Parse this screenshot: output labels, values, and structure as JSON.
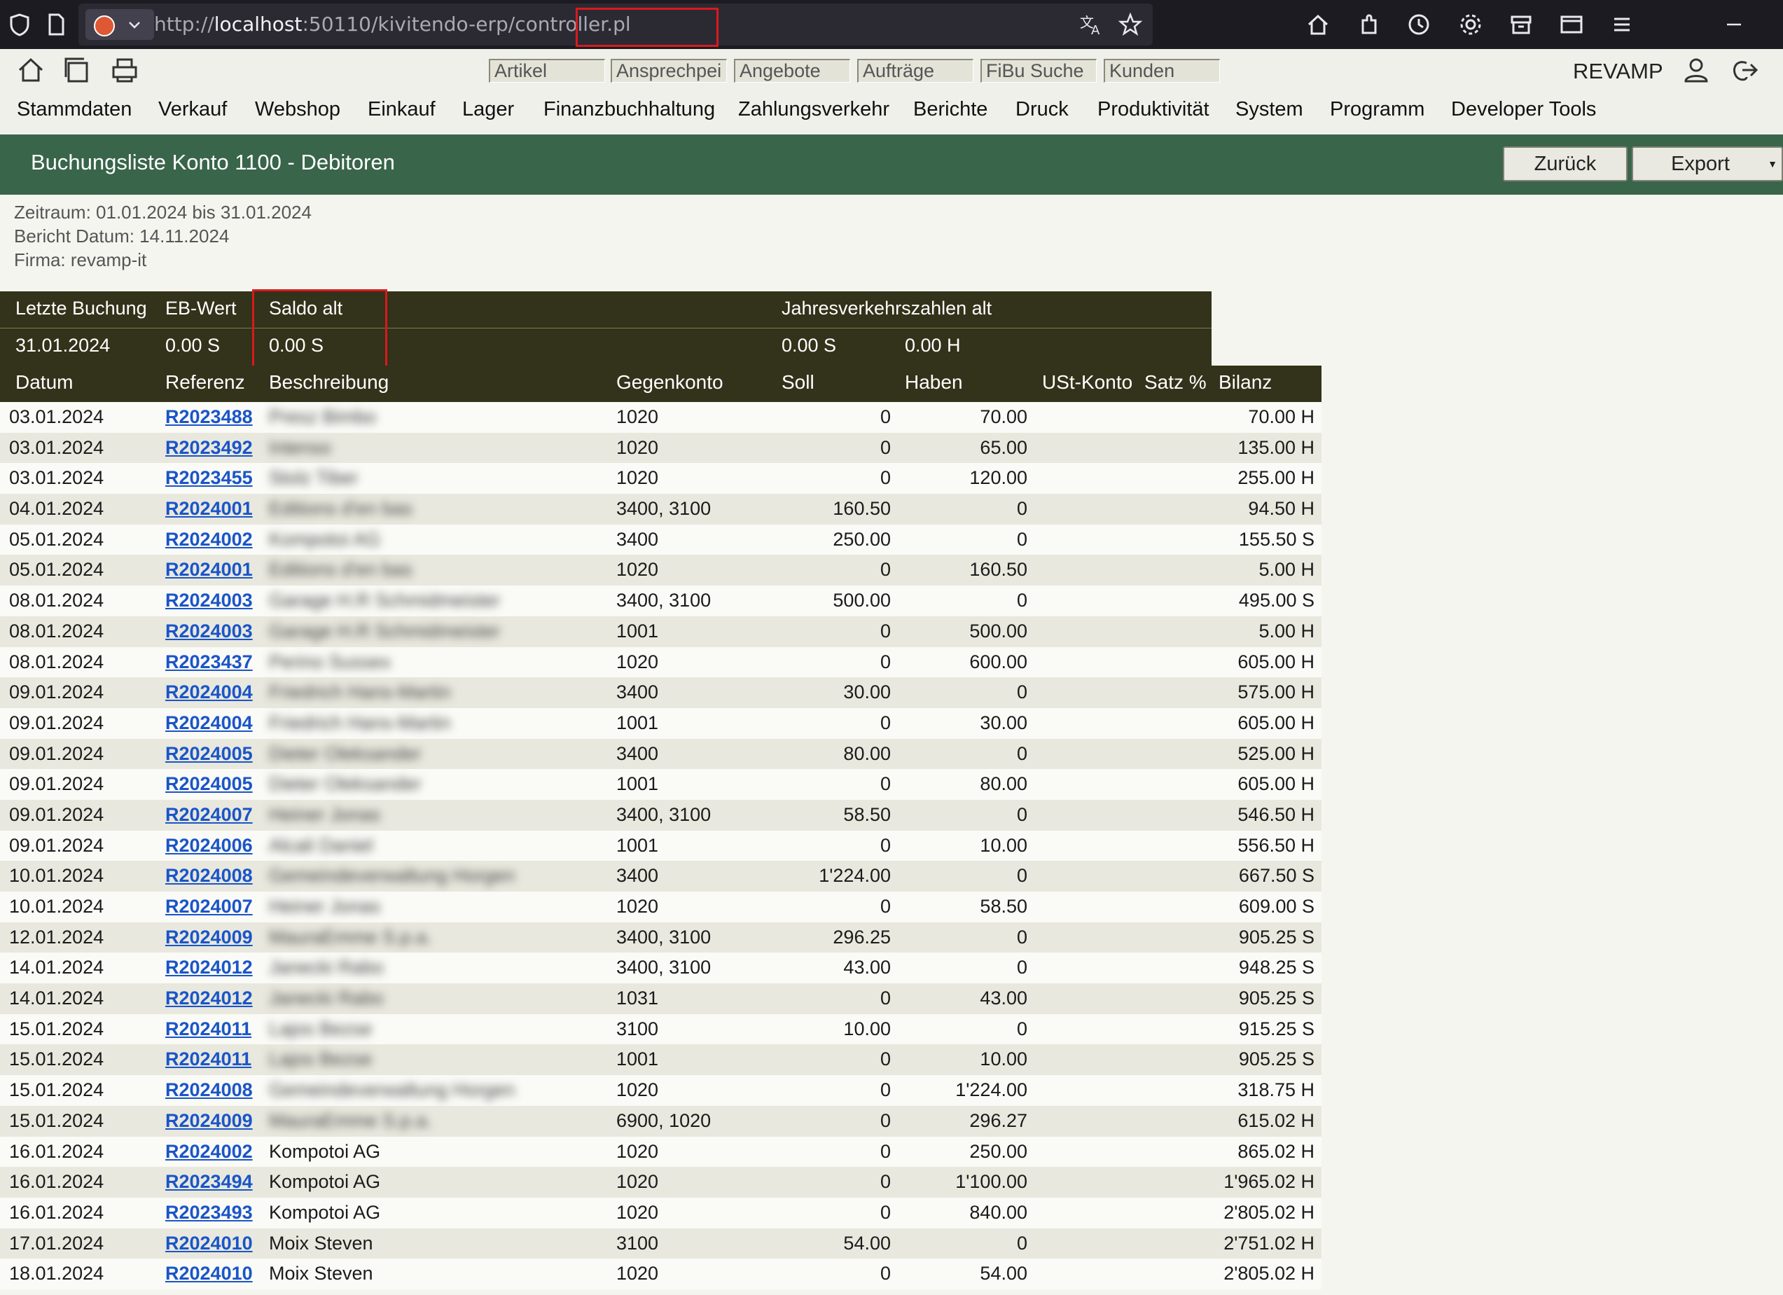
{
  "browser": {
    "url_prefix": "http://",
    "url_host": "localhost",
    "url_path": ":50110/kivitendo-erp/",
    "url_highlight": "controller.pl"
  },
  "quick_tabs": [
    "Artikel",
    "Ansprechpei",
    "Angebote",
    "Aufträge",
    "FiBu Suche",
    "Kunden"
  ],
  "user": "REVAMP",
  "menu": [
    "Stammdaten",
    "Verkauf",
    "Webshop",
    "Einkauf",
    "Lager",
    "Finanzbuchhaltung",
    "Zahlungsverkehr",
    "Berichte",
    "Druck",
    "Produktivität",
    "System",
    "Programm",
    "Developer Tools"
  ],
  "page": {
    "title": "Buchungsliste Konto 1100 - Debitoren",
    "back_label": "Zurück",
    "export_label": "Export"
  },
  "meta": {
    "zeitraum": "Zeitraum: 01.01.2024 bis 31.01.2024",
    "bericht_datum": "Bericht Datum: 14.11.2024",
    "firma": "Firma: revamp-it"
  },
  "summary": {
    "h_letzte": "Letzte Buchung",
    "h_eb": "EB-Wert",
    "h_saldo": "Saldo alt",
    "h_jvz": "Jahresverkehrszahlen alt",
    "v_letzte": "31.01.2024",
    "v_eb": "0.00 S",
    "v_saldo": "0.00 S",
    "v_jvz_soll": "0.00 S",
    "v_jvz_haben": "0.00 H"
  },
  "table": {
    "headers": {
      "datum": "Datum",
      "referenz": "Referenz",
      "beschreibung": "Beschreibung",
      "gegenkonto": "Gegenkonto",
      "soll": "Soll",
      "haben": "Haben",
      "ust": "USt-Konto",
      "satz": "Satz %",
      "bilanz": "Bilanz"
    },
    "rows": [
      {
        "datum": "03.01.2024",
        "ref": "R2023488",
        "desc": "Presz Bimbo",
        "gk": "1020",
        "soll": "0",
        "haben": "70.00",
        "bilanz": "70.00 H",
        "blur": true
      },
      {
        "datum": "03.01.2024",
        "ref": "R2023492",
        "desc": "Intenso",
        "gk": "1020",
        "soll": "0",
        "haben": "65.00",
        "bilanz": "135.00 H",
        "blur": true
      },
      {
        "datum": "03.01.2024",
        "ref": "R2023455",
        "desc": "Stolz Tiber",
        "gk": "1020",
        "soll": "0",
        "haben": "120.00",
        "bilanz": "255.00 H",
        "blur": true
      },
      {
        "datum": "04.01.2024",
        "ref": "R2024001",
        "desc": "Editions d'en bas",
        "gk": "3400, 3100",
        "soll": "160.50",
        "haben": "0",
        "bilanz": "94.50 H",
        "blur": true
      },
      {
        "datum": "05.01.2024",
        "ref": "R2024002",
        "desc": "Kompotoi AG",
        "gk": "3400",
        "soll": "250.00",
        "haben": "0",
        "bilanz": "155.50 S",
        "blur": true
      },
      {
        "datum": "05.01.2024",
        "ref": "R2024001",
        "desc": "Editions d'en bas",
        "gk": "1020",
        "soll": "0",
        "haben": "160.50",
        "bilanz": "5.00 H",
        "blur": true
      },
      {
        "datum": "08.01.2024",
        "ref": "R2024003",
        "desc": "Garage H.R Schmidmeister",
        "gk": "3400, 3100",
        "soll": "500.00",
        "haben": "0",
        "bilanz": "495.00 S",
        "blur": true
      },
      {
        "datum": "08.01.2024",
        "ref": "R2024003",
        "desc": "Garage H.R Schmidmeister",
        "gk": "1001",
        "soll": "0",
        "haben": "500.00",
        "bilanz": "5.00 H",
        "blur": true
      },
      {
        "datum": "08.01.2024",
        "ref": "R2023437",
        "desc": "Perino Sussex",
        "gk": "1020",
        "soll": "0",
        "haben": "600.00",
        "bilanz": "605.00 H",
        "blur": true
      },
      {
        "datum": "09.01.2024",
        "ref": "R2024004",
        "desc": "Friedrich Hans-Martin",
        "gk": "3400",
        "soll": "30.00",
        "haben": "0",
        "bilanz": "575.00 H",
        "blur": true
      },
      {
        "datum": "09.01.2024",
        "ref": "R2024004",
        "desc": "Friedrich Hans-Martin",
        "gk": "1001",
        "soll": "0",
        "haben": "30.00",
        "bilanz": "605.00 H",
        "blur": true
      },
      {
        "datum": "09.01.2024",
        "ref": "R2024005",
        "desc": "Dieter Oleksander",
        "gk": "3400",
        "soll": "80.00",
        "haben": "0",
        "bilanz": "525.00 H",
        "blur": true
      },
      {
        "datum": "09.01.2024",
        "ref": "R2024005",
        "desc": "Dieter Oleksander",
        "gk": "1001",
        "soll": "0",
        "haben": "80.00",
        "bilanz": "605.00 H",
        "blur": true
      },
      {
        "datum": "09.01.2024",
        "ref": "R2024007",
        "desc": "Heiner Jonas",
        "gk": "3400, 3100",
        "soll": "58.50",
        "haben": "0",
        "bilanz": "546.50 H",
        "blur": true
      },
      {
        "datum": "09.01.2024",
        "ref": "R2024006",
        "desc": "Alcali Daniel",
        "gk": "1001",
        "soll": "0",
        "haben": "10.00",
        "bilanz": "556.50 H",
        "blur": true
      },
      {
        "datum": "10.01.2024",
        "ref": "R2024008",
        "desc": "Gemeindeverwaltung Horgen",
        "gk": "3400",
        "soll": "1'224.00",
        "haben": "0",
        "bilanz": "667.50 S",
        "blur": true
      },
      {
        "datum": "10.01.2024",
        "ref": "R2024007",
        "desc": "Heiner Jonas",
        "gk": "1020",
        "soll": "0",
        "haben": "58.50",
        "bilanz": "609.00 S",
        "blur": true
      },
      {
        "datum": "12.01.2024",
        "ref": "R2024009",
        "desc": "MauraEmme S.p.a.",
        "gk": "3400, 3100",
        "soll": "296.25",
        "haben": "0",
        "bilanz": "905.25 S",
        "blur": true
      },
      {
        "datum": "14.01.2024",
        "ref": "R2024012",
        "desc": "Janecki Rabo",
        "gk": "3400, 3100",
        "soll": "43.00",
        "haben": "0",
        "bilanz": "948.25 S",
        "blur": true
      },
      {
        "datum": "14.01.2024",
        "ref": "R2024012",
        "desc": "Janecki Rabo",
        "gk": "1031",
        "soll": "0",
        "haben": "43.00",
        "bilanz": "905.25 S",
        "blur": true
      },
      {
        "datum": "15.01.2024",
        "ref": "R2024011",
        "desc": "Lajos Bezse",
        "gk": "3100",
        "soll": "10.00",
        "haben": "0",
        "bilanz": "915.25 S",
        "blur": true
      },
      {
        "datum": "15.01.2024",
        "ref": "R2024011",
        "desc": "Lajos Bezse",
        "gk": "1001",
        "soll": "0",
        "haben": "10.00",
        "bilanz": "905.25 S",
        "blur": true
      },
      {
        "datum": "15.01.2024",
        "ref": "R2024008",
        "desc": "Gemeindeverwaltung Horgen",
        "gk": "1020",
        "soll": "0",
        "haben": "1'224.00",
        "bilanz": "318.75 H",
        "blur": true
      },
      {
        "datum": "15.01.2024",
        "ref": "R2024009",
        "desc": "MauraEmme S.p.a.",
        "gk": "6900, 1020",
        "soll": "0",
        "haben": "296.27",
        "bilanz": "615.02 H",
        "blur": true
      },
      {
        "datum": "16.01.2024",
        "ref": "R2024002",
        "desc": "Kompotoi AG",
        "gk": "1020",
        "soll": "0",
        "haben": "250.00",
        "bilanz": "865.02 H",
        "blur": false
      },
      {
        "datum": "16.01.2024",
        "ref": "R2023494",
        "desc": "Kompotoi AG",
        "gk": "1020",
        "soll": "0",
        "haben": "1'100.00",
        "bilanz": "1'965.02 H",
        "blur": false
      },
      {
        "datum": "16.01.2024",
        "ref": "R2023493",
        "desc": "Kompotoi AG",
        "gk": "1020",
        "soll": "0",
        "haben": "840.00",
        "bilanz": "2'805.02 H",
        "blur": false
      },
      {
        "datum": "17.01.2024",
        "ref": "R2024010",
        "desc": "Moix Steven",
        "gk": "3100",
        "soll": "54.00",
        "haben": "0",
        "bilanz": "2'751.02 H",
        "blur": false
      },
      {
        "datum": "18.01.2024",
        "ref": "R2024010",
        "desc": "Moix Steven",
        "gk": "1020",
        "soll": "0",
        "haben": "54.00",
        "bilanz": "2'805.02 H",
        "blur": false
      }
    ]
  }
}
